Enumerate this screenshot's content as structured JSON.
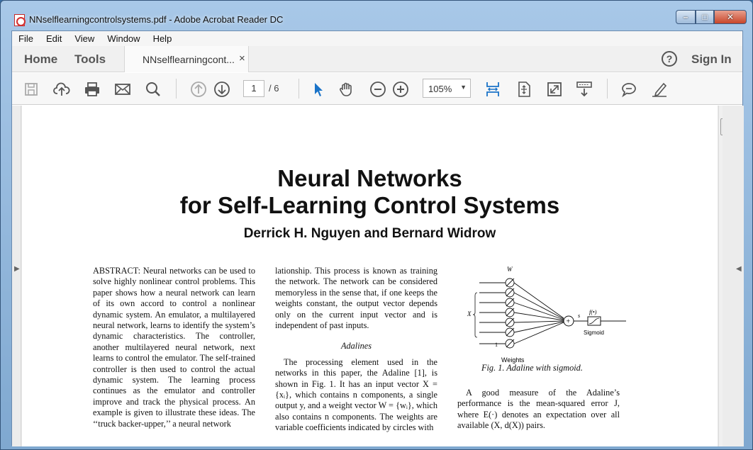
{
  "window": {
    "title": "NNselflearningcontrolsystems.pdf - Adobe Acrobat Reader DC",
    "minimize": "–",
    "maximize": "□",
    "close": "✕"
  },
  "menu": [
    "File",
    "Edit",
    "View",
    "Window",
    "Help"
  ],
  "tabs": {
    "home": "Home",
    "tools": "Tools",
    "document": "NNselflearningcont...",
    "close": "×",
    "help": "?",
    "sign_in": "Sign In"
  },
  "toolbar": {
    "page_current": "1",
    "page_total": "/ 6",
    "zoom": "105%",
    "icons": [
      "save-icon",
      "upload-cloud-icon",
      "print-icon",
      "email-icon",
      "search-icon",
      "previous-page-icon",
      "next-page-icon",
      "select-cursor-icon",
      "hand-tool-icon",
      "zoom-out-icon",
      "zoom-in-icon",
      "scroll-mode-icon",
      "fit-page-icon",
      "full-screen-icon",
      "read-mode-icon",
      "comment-icon",
      "sign-icon"
    ]
  },
  "paper": {
    "title_line1": "Neural Networks",
    "title_line2": "for Self-Learning Control Systems",
    "authors": "Derrick H. Nguyen and Bernard Widrow",
    "col1": "ABSTRACT: Neural networks can be used to solve highly nonlinear control problems. This paper shows how a neural network can learn of its own accord to control a nonlinear dynamic system. An emulator, a multilayered neural network, learns to identify the system’s dynamic characteristics. The controller, another multilayered neural network, next learns to control the emulator. The self-trained controller is then used to control the actual dynamic system. The learning process continues as the emulator and controller improve and track the physical process. An example is given to illustrate these ideas. The ‘‘truck backer-upper,’’ a neural network",
    "col2_p1": "lationship. This process is known as training the network. The network can be considered memoryless in the sense that, if one keeps the weights constant, the output vector depends only on the current input vector and is independent of past inputs.",
    "col2_heading": "Adalines",
    "col2_p2": "The processing element used in the networks in this paper, the Adaline [1], is shown in Fig. 1. It has an input vector X = {xᵢ}, which contains n components, a single output y, and a weight vector W = {wᵢ}, which also contains n components. The weights are variable coefficients indicated by circles with",
    "fig_label_w": "W",
    "fig_label_x": "X",
    "fig_label_one": "1",
    "fig_label_weights": "Weights",
    "fig_label_s": "s",
    "fig_label_f": "f(•)",
    "fig_label_sigmoid": "Sigmoid",
    "fig_label_y": "y",
    "fig_caption": "Fig. 1.   Adaline with sigmoid.",
    "col3": "A good measure of the Adaline’s performance is the mean-squared error J, where E(·) denotes an expectation over all available (X, d(X)) pairs."
  }
}
